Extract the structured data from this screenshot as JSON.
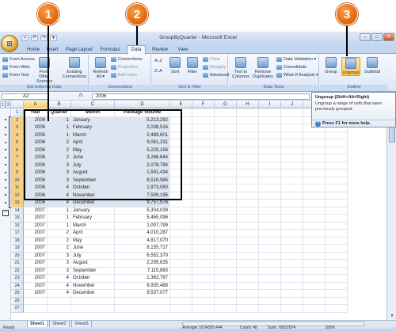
{
  "callouts": {
    "c1": "1",
    "c2": "2",
    "c3": "3"
  },
  "window": {
    "title": "GroupByQuarter - Microsoft Excel",
    "min": "–",
    "max": "□",
    "close": "✕"
  },
  "qat": {
    "save": "▪",
    "undo": "↶",
    "redo": "↷",
    "more": "▾"
  },
  "office_button": "⊞",
  "tabs": [
    "Home",
    "Insert",
    "Page Layout",
    "Formulas",
    "Data",
    "Review",
    "View"
  ],
  "active_tab": "Data",
  "ribbon": {
    "get_external": {
      "label": "Get External Data",
      "from_access": "From Access",
      "from_web": "From Web",
      "from_text": "From Text",
      "from_other": "From Other Sources ▾",
      "existing": "Existing Connections"
    },
    "connections": {
      "label": "Connections",
      "refresh": "Refresh All ▾",
      "connections": "Connections",
      "properties": "Properties",
      "edit_links": "Edit Links"
    },
    "sort_filter": {
      "label": "Sort & Filter",
      "az": "A↓Z",
      "za": "Z↓A",
      "sort": "Sort",
      "filter": "Filter",
      "clear": "Clear",
      "reapply": "Reapply",
      "advanced": "Advanced"
    },
    "data_tools": {
      "label": "Data Tools",
      "text_to_columns": "Text to Columns",
      "remove_dup": "Remove Duplicates",
      "validation": "Data Validation ▾",
      "consolidate": "Consolidate",
      "whatif": "What-If Analysis ▾"
    },
    "outline": {
      "label": "Outline",
      "group": "Group",
      "ungroup": "Ungroup",
      "subtotal": "Subtotal"
    }
  },
  "namebox": "A2",
  "fx": "fx",
  "formula": "2006",
  "tooltip": {
    "title": "Ungroup (Shift+Alt+Right)",
    "body": "Ungroup a range of cells that were previously grouped.",
    "help": "Press F1 for more help."
  },
  "outline_levels": [
    "1",
    "2"
  ],
  "columns": [
    "A",
    "B",
    "C",
    "D",
    "E",
    "F",
    "G",
    "H",
    "I",
    "J",
    "K",
    "L"
  ],
  "headers": {
    "year": "Year",
    "quarter": "Quarter",
    "month": "Month",
    "volume": "Package Volume"
  },
  "rows": [
    {
      "n": "2",
      "year": "2006",
      "q": "1",
      "month": "January",
      "vol": "5,213,292"
    },
    {
      "n": "3",
      "year": "2006",
      "q": "1",
      "month": "February",
      "vol": "2,038,516"
    },
    {
      "n": "4",
      "year": "2006",
      "q": "1",
      "month": "March",
      "vol": "2,489,601"
    },
    {
      "n": "5",
      "year": "2006",
      "q": "2",
      "month": "April",
      "vol": "9,061,231"
    },
    {
      "n": "6",
      "year": "2006",
      "q": "2",
      "month": "May",
      "vol": "5,225,156"
    },
    {
      "n": "7",
      "year": "2006",
      "q": "2",
      "month": "June",
      "vol": "3,266,644"
    },
    {
      "n": "8",
      "year": "2006",
      "q": "3",
      "month": "July",
      "vol": "2,078,794"
    },
    {
      "n": "9",
      "year": "2006",
      "q": "3",
      "month": "August",
      "vol": "1,591,434"
    },
    {
      "n": "10",
      "year": "2006",
      "q": "3",
      "month": "September",
      "vol": "8,518,985"
    },
    {
      "n": "11",
      "year": "2006",
      "q": "4",
      "month": "October",
      "vol": "1,973,050"
    },
    {
      "n": "12",
      "year": "2006",
      "q": "4",
      "month": "November",
      "vol": "7,599,195"
    },
    {
      "n": "13",
      "year": "2006",
      "q": "4",
      "month": "December",
      "vol": "9,757,976"
    },
    {
      "n": "14",
      "year": "2007",
      "q": "1",
      "month": "January",
      "vol": "5,304,039"
    },
    {
      "n": "15",
      "year": "2007",
      "q": "1",
      "month": "February",
      "vol": "5,465,096"
    },
    {
      "n": "16",
      "year": "2007",
      "q": "1",
      "month": "March",
      "vol": "1,007,799"
    },
    {
      "n": "17",
      "year": "2007",
      "q": "2",
      "month": "April",
      "vol": "4,010,287"
    },
    {
      "n": "18",
      "year": "2007",
      "q": "2",
      "month": "May",
      "vol": "4,817,070"
    },
    {
      "n": "19",
      "year": "2007",
      "q": "2",
      "month": "June",
      "vol": "8,155,717"
    },
    {
      "n": "20",
      "year": "2007",
      "q": "3",
      "month": "July",
      "vol": "6,552,370"
    },
    {
      "n": "21",
      "year": "2007",
      "q": "3",
      "month": "August",
      "vol": "2,295,635"
    },
    {
      "n": "22",
      "year": "2007",
      "q": "3",
      "month": "September",
      "vol": "7,115,883"
    },
    {
      "n": "23",
      "year": "2007",
      "q": "4",
      "month": "October",
      "vol": "1,362,767"
    },
    {
      "n": "24",
      "year": "2007",
      "q": "4",
      "month": "November",
      "vol": "8,935,488"
    },
    {
      "n": "25",
      "year": "2007",
      "q": "4",
      "month": "December",
      "vol": "9,537,077"
    },
    {
      "n": "26",
      "year": "",
      "q": "",
      "month": "",
      "vol": ""
    },
    {
      "n": "27",
      "year": "",
      "q": "",
      "month": "",
      "vol": ""
    }
  ],
  "sheets": [
    "Sheet1",
    "Sheet2",
    "Sheet3"
  ],
  "status": {
    "ready": "Ready",
    "average": "Average: 1634395.444",
    "count": "Count: 48",
    "sum": "Sum: 78837874",
    "zoom": "100%"
  }
}
